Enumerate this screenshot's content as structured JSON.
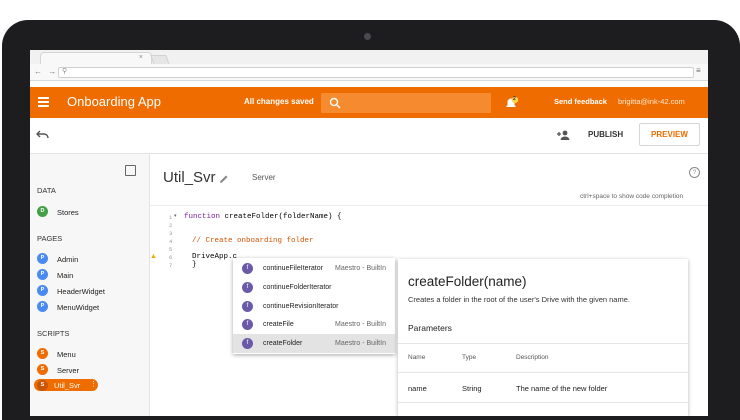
{
  "browser": {
    "tab_close": "×",
    "nav": "← → C",
    "search_glyph": "⚲",
    "menu_glyph": "≡"
  },
  "app": {
    "title": "Onboarding App",
    "status": "All changes saved",
    "search_placeholder": "",
    "notification_count": "2",
    "send_feedback": "Send feedback",
    "user_email": "brigitta@ink-42.com",
    "accent_color": "#ef6c00"
  },
  "toolbar": {
    "publish": "PUBLISH",
    "preview": "PREVIEW"
  },
  "sidebar": {
    "data_label": "DATA",
    "data_items": [
      {
        "badge": "D",
        "label": "Stores",
        "color": "#43a047"
      }
    ],
    "pages_label": "PAGES",
    "pages_items": [
      {
        "badge": "P",
        "label": "Admin",
        "color": "#4a8af4"
      },
      {
        "badge": "P",
        "label": "Main",
        "color": "#4a8af4"
      },
      {
        "badge": "P",
        "label": "HeaderWidget",
        "color": "#4a8af4"
      },
      {
        "badge": "P",
        "label": "MenuWidget",
        "color": "#4a8af4"
      }
    ],
    "scripts_label": "SCRIPTS",
    "scripts_items": [
      {
        "badge": "S",
        "label": "Menu",
        "color": "#ef6c00"
      },
      {
        "badge": "S",
        "label": "Server",
        "color": "#ef6c00"
      },
      {
        "badge": "S",
        "label": "Util_Svr",
        "color": "#ef6c00",
        "selected": true
      }
    ]
  },
  "editor": {
    "filename": "Util_Svr",
    "file_type": "Server",
    "hint": "ctrl+space to show code completion",
    "line_numbers": [
      "1",
      "2",
      "3",
      "4",
      "5",
      "6",
      "7"
    ],
    "code": {
      "l1_kw": "function",
      "l1_rest": " createFolder(folderName) {",
      "l4_comment": "// Create onboarding folder",
      "l6": "DriveApp.c",
      "l7": "}"
    }
  },
  "autocomplete": {
    "items": [
      {
        "icon": "f",
        "name": "continueFileIterator",
        "source": "Maestro - BuiltIn"
      },
      {
        "icon": "f",
        "name": "continueFolderIterator",
        "source": ""
      },
      {
        "icon": "f",
        "name": "continueRevisionIterator",
        "source": ""
      },
      {
        "icon": "f",
        "name": "createFile",
        "source": "Maestro - BuiltIn"
      },
      {
        "icon": "f",
        "name": "createFolder",
        "source": "Maestro - BuiltIn",
        "active": true
      }
    ]
  },
  "doc": {
    "title": "createFolder(name)",
    "description": "Creates a folder in the root of the user's Drive with the given name.",
    "parameters_label": "Parameters",
    "columns": [
      "Name",
      "Type",
      "Description"
    ],
    "rows": [
      {
        "name": "name",
        "type": "String",
        "description": "The name of the new folder"
      }
    ]
  }
}
